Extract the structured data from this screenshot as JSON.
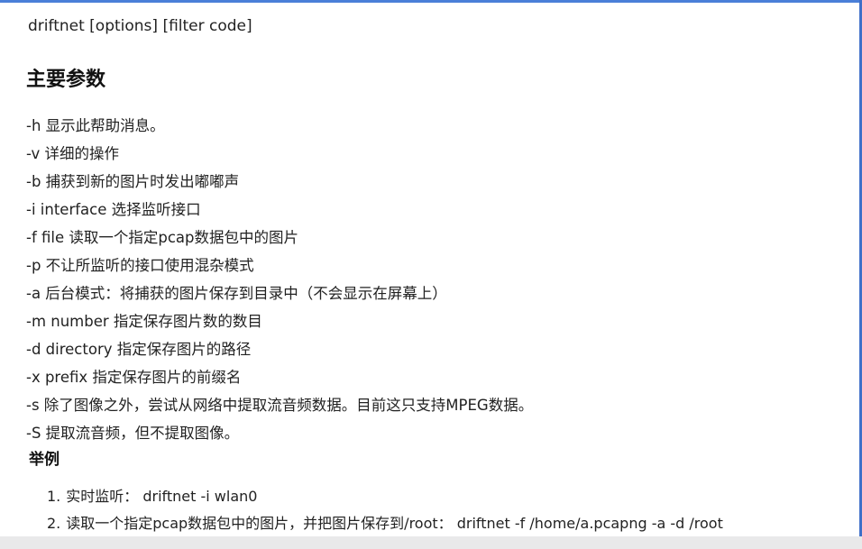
{
  "usage_line": "driftnet [options] [filter code]",
  "sections": {
    "params_heading": "主要参数",
    "examples_heading": "举例"
  },
  "params": [
    "-h 显示此帮助消息。",
    "-v 详细的操作",
    "-b 捕获到新的图片时发出嘟嘟声",
    "-i interface 选择监听接口",
    "-f file 读取一个指定pcap数据包中的图片",
    "-p 不让所监听的接口使用混杂模式",
    "-a 后台模式：将捕获的图片保存到目录中（不会显示在屏幕上）",
    "-m number 指定保存图片数的数目",
    "-d directory 指定保存图片的路径",
    "-x prefix 指定保存图片的前缀名",
    "-s 除了图像之外，尝试从网络中提取流音频数据。目前这只支持MPEG数据。",
    "-S 提取流音频，但不提取图像。"
  ],
  "examples": [
    {
      "num": "1.",
      "text": "实时监听： driftnet -i wlan0"
    },
    {
      "num": "2.",
      "text": "读取一个指定pcap数据包中的图片，并把图片保存到/root： driftnet -f /home/a.pcapng -a -d /root"
    }
  ],
  "colors": {
    "accent": "#4a7fd8",
    "text": "#222222",
    "bottom_strip": "#e9e9ea"
  }
}
